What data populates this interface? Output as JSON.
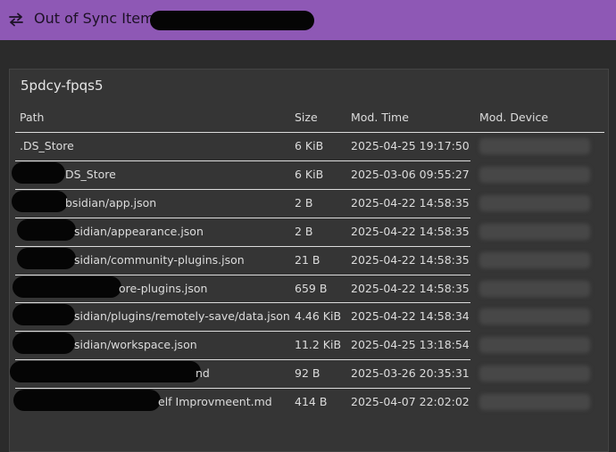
{
  "header": {
    "title": "Out of Sync Items",
    "icon": "swap-arrows-icon"
  },
  "panel": {
    "title": "5pdcy-fpqs5"
  },
  "table": {
    "columns": [
      "Path",
      "Size",
      "Mod. Time",
      "Mod. Device"
    ],
    "rows": [
      {
        "path": ".DS_Store",
        "size": "6 KiB",
        "time": "2025-04-25 19:17:50"
      },
      {
        "path": "DS_Store",
        "size": "6 KiB",
        "time": "2025-03-06 09:55:27"
      },
      {
        "path": "bsidian/app.json",
        "size": "2 B",
        "time": "2025-04-22 14:58:35"
      },
      {
        "path": "sidian/appearance.json",
        "size": "2 B",
        "time": "2025-04-22 14:58:35"
      },
      {
        "path": "sidian/community-plugins.json",
        "size": "21 B",
        "time": "2025-04-22 14:58:35"
      },
      {
        "path": "ore-plugins.json",
        "size": "659 B",
        "time": "2025-04-22 14:58:35"
      },
      {
        "path": "sidian/plugins/remotely-save/data.json",
        "size": "4.46 KiB",
        "time": "2025-04-22 14:58:34"
      },
      {
        "path": "sidian/workspace.json",
        "size": "11.2 KiB",
        "time": "2025-04-25 13:18:54"
      },
      {
        "path": "nd",
        "size": "92 B",
        "time": "2025-03-26 20:35:31"
      },
      {
        "path": "elf Improvmeent.md",
        "size": "414 B",
        "time": "2025-04-07 22:02:02"
      }
    ]
  }
}
